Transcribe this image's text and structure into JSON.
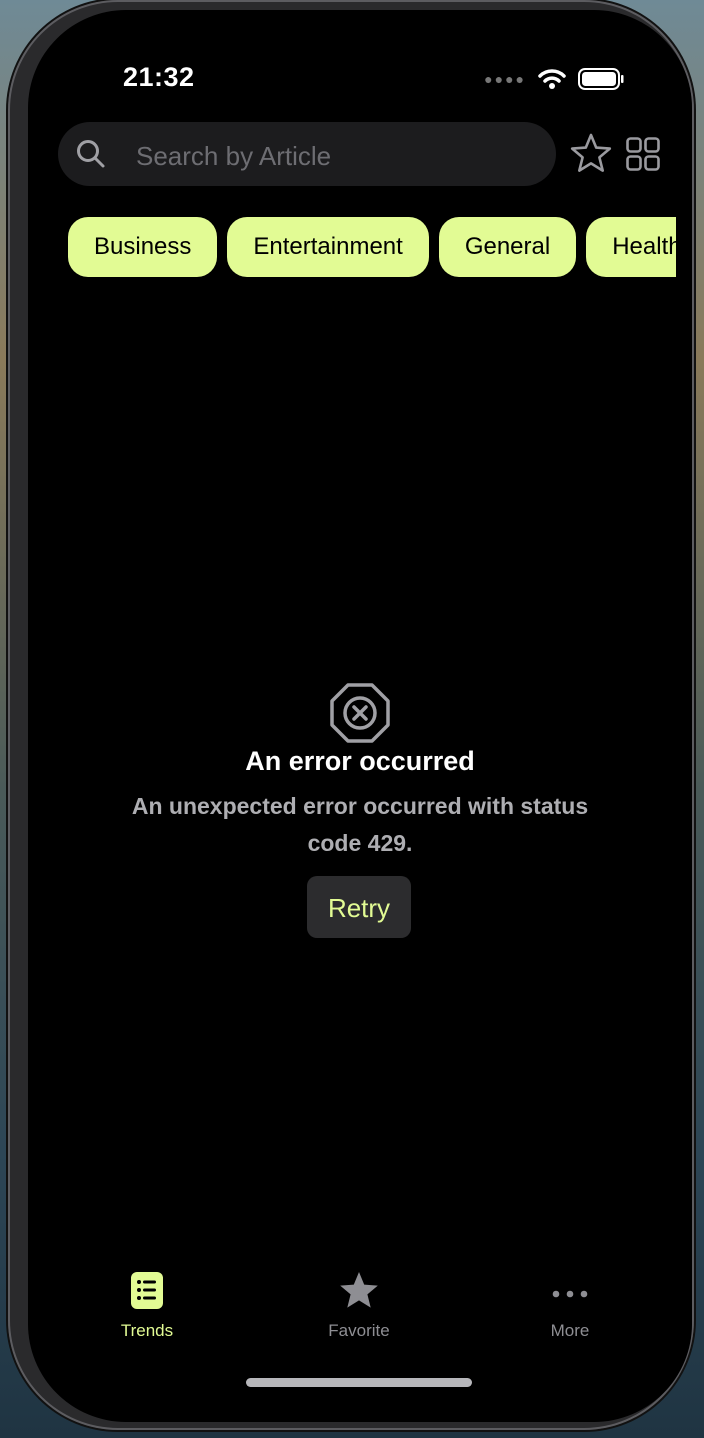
{
  "status_bar": {
    "time": "21:32"
  },
  "search": {
    "placeholder": "Search by Article"
  },
  "categories": [
    "Business",
    "Entertainment",
    "General",
    "Health"
  ],
  "error": {
    "title": "An error occurred",
    "message": "An unexpected error occurred with status code 429.",
    "retry_label": "Retry"
  },
  "tabbar": {
    "items": [
      {
        "label": "Trends",
        "icon": "list-icon",
        "active": true
      },
      {
        "label": "Favorite",
        "icon": "star-icon",
        "active": false
      },
      {
        "label": "More",
        "icon": "ellipsis-icon",
        "active": false
      }
    ]
  },
  "colors": {
    "accent": "#e2fb94",
    "background": "#000000",
    "inactive": "#8e8e93",
    "search_bg": "#1c1c1e"
  }
}
